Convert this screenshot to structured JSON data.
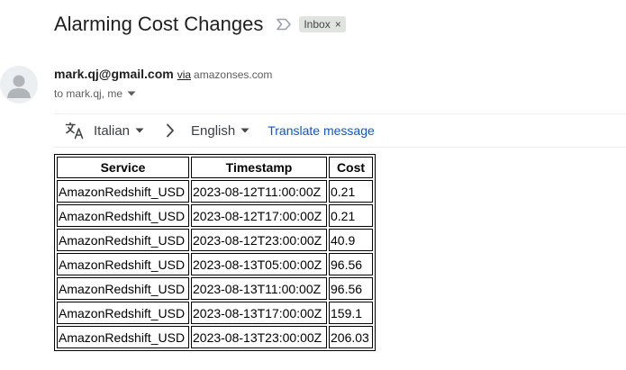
{
  "email": {
    "subject": "Alarming Cost Changes",
    "label": "Inbox",
    "label_remove": "×",
    "sender": "mark.qj@gmail.com",
    "via": "via",
    "via_domain": "amazonses.com",
    "recipients": "to mark.qj, me"
  },
  "icons": {
    "important": "importance-marker-icon",
    "avatar": "person-icon",
    "translate": "translate-icon",
    "caret": "caret-down-icon",
    "arrow": "chevron-right-icon"
  },
  "translate_bar": {
    "from_language": "Italian",
    "to_language": "English",
    "action": "Translate message"
  },
  "table": {
    "headers": [
      "Service",
      "Timestamp",
      "Cost"
    ],
    "rows": [
      [
        "AmazonRedshift_USD",
        "2023-08-12T11:00:00Z",
        "0.21"
      ],
      [
        "AmazonRedshift_USD",
        "2023-08-12T17:00:00Z",
        "0.21"
      ],
      [
        "AmazonRedshift_USD",
        "2023-08-12T23:00:00Z",
        "40.9"
      ],
      [
        "AmazonRedshift_USD",
        "2023-08-13T05:00:00Z",
        "96.56"
      ],
      [
        "AmazonRedshift_USD",
        "2023-08-13T11:00:00Z",
        "96.56"
      ],
      [
        "AmazonRedshift_USD",
        "2023-08-13T17:00:00Z",
        "159.1"
      ],
      [
        "AmazonRedshift_USD",
        "2023-08-13T23:00:00Z",
        "206.03"
      ]
    ]
  },
  "colors": {
    "link": "#0b57d0",
    "label_chip_bg": "#e1e3e1",
    "avatar_bg": "#eceff1",
    "avatar_fg": "#b0b5b9"
  }
}
